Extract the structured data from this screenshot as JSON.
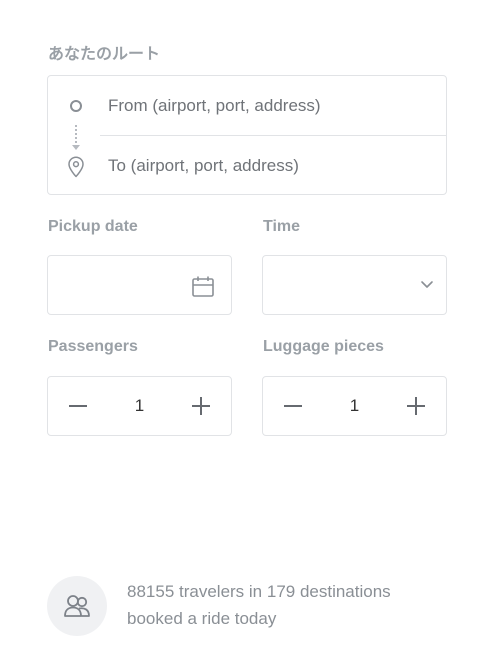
{
  "route": {
    "section_label": "あなたのルート",
    "from_placeholder": "From (airport, port, address)",
    "to_placeholder": "To (airport, port, address)"
  },
  "pickup": {
    "label": "Pickup date",
    "value": ""
  },
  "time": {
    "label": "Time",
    "value": ""
  },
  "passengers": {
    "label": "Passengers",
    "value": "1"
  },
  "luggage": {
    "label": "Luggage pieces",
    "value": "1"
  },
  "stats": {
    "line1": "88155 travelers in 179 destinations",
    "line2": "booked a ride today"
  },
  "colors": {
    "label": "#9aa0a6",
    "border": "#e1e3e6",
    "icon": "#8a8f95",
    "footer_bg": "#f0f1f3"
  },
  "icons": [
    "origin-circle-icon",
    "route-dots-icon",
    "location-pin-icon",
    "calendar-icon",
    "chevron-down-icon",
    "minus-icon",
    "plus-icon",
    "travelers-icon"
  ]
}
